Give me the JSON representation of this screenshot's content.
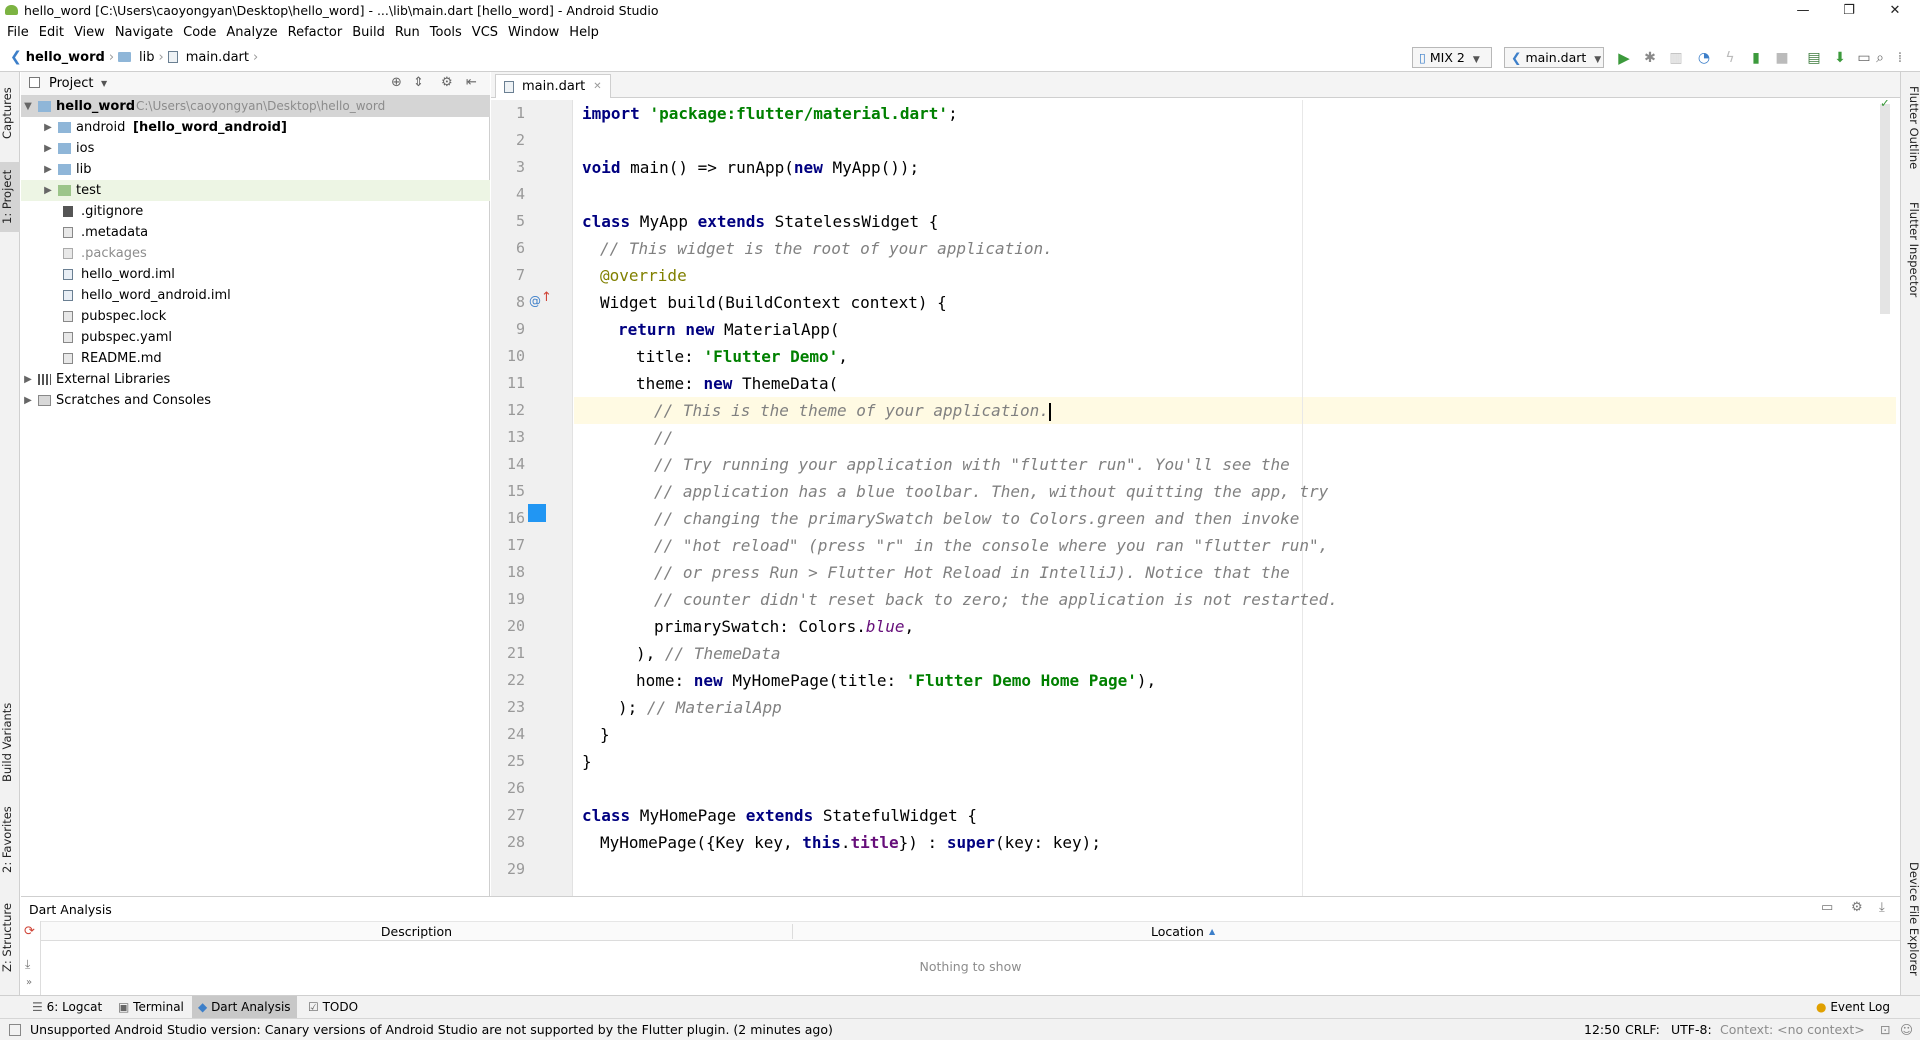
{
  "window": {
    "title": "hello_word [C:\\Users\\caoyongyan\\Desktop\\hello_word] - ...\\lib\\main.dart [hello_word] - Android Studio",
    "minimize": "—",
    "restore": "❐",
    "close": "✕"
  },
  "menu": [
    "File",
    "Edit",
    "View",
    "Navigate",
    "Code",
    "Analyze",
    "Refactor",
    "Build",
    "Run",
    "Tools",
    "VCS",
    "Window",
    "Help"
  ],
  "breadcrumb": {
    "project": "hello_word",
    "folder": "lib",
    "file": "main.dart"
  },
  "toolbar": {
    "device": "MIX 2",
    "run_config": "main.dart"
  },
  "left_strip": {
    "captures": "Captures",
    "project": "1: Project",
    "build_variants": "Build Variants",
    "favorites": "2: Favorites",
    "structure": "Z: Structure"
  },
  "right_strip": {
    "outline": "Flutter Outline",
    "inspector": "Flutter Inspector",
    "device_explorer": "Device File Explorer"
  },
  "project_panel": {
    "view_label": "Project",
    "root": {
      "name": "hello_word",
      "path": "C:\\Users\\caoyongyan\\Desktop\\hello_word"
    },
    "items": [
      {
        "name": "android",
        "suffix": "[hello_word_android]",
        "kind": "folder"
      },
      {
        "name": "ios",
        "kind": "folder"
      },
      {
        "name": "lib",
        "kind": "folder"
      },
      {
        "name": "test",
        "kind": "folder"
      },
      {
        "name": ".gitignore",
        "kind": "file"
      },
      {
        "name": ".metadata",
        "kind": "file"
      },
      {
        "name": ".packages",
        "kind": "file"
      },
      {
        "name": "hello_word.iml",
        "kind": "file"
      },
      {
        "name": "hello_word_android.iml",
        "kind": "file"
      },
      {
        "name": "pubspec.lock",
        "kind": "file"
      },
      {
        "name": "pubspec.yaml",
        "kind": "file"
      },
      {
        "name": "README.md",
        "kind": "file"
      }
    ],
    "external": "External Libraries",
    "scratches": "Scratches and Consoles"
  },
  "editor": {
    "tab": "main.dart",
    "line_numbers": [
      "1",
      "2",
      "3",
      "4",
      "5",
      "6",
      "7",
      "8",
      "9",
      "10",
      "11",
      "12",
      "13",
      "14",
      "15",
      "16",
      "17",
      "18",
      "19",
      "20",
      "21",
      "22",
      "23",
      "24",
      "25",
      "26",
      "27",
      "28",
      "29"
    ],
    "lines": {
      "l1": {
        "kw": "import",
        "s": "'package:flutter/material.dart'",
        "t": ";"
      },
      "l3": {
        "kw": "void",
        "t1": " main() => runApp(",
        "kw2": "new",
        "t2": " MyApp());"
      },
      "l5": {
        "kw": "class",
        "t1": " MyApp ",
        "kw2": "extends",
        "t2": " StatelessWidget {"
      },
      "l6": "// This widget is the root of your application.",
      "l7": "@override",
      "l8": "Widget build(BuildContext context) {",
      "l9": {
        "kw": "return new",
        "t": " MaterialApp("
      },
      "l10": {
        "t": "title: ",
        "s": "'Flutter Demo'",
        "t2": ","
      },
      "l11": {
        "t": "theme: ",
        "kw": "new",
        "t2": " ThemeData("
      },
      "l12": "// This is the theme of your application.",
      "l13": "//",
      "l14": "// Try running your application with \"flutter run\". You'll see the",
      "l15": "// application has a blue toolbar. Then, without quitting the app, try",
      "l16": "// changing the primarySwatch below to Colors.green and then invoke",
      "l17": "// \"hot reload\" (press \"r\" in the console where you ran \"flutter run\",",
      "l18": "// or press Run > Flutter Hot Reload in IntelliJ). Notice that the",
      "l19": "// counter didn't reset back to zero; the application is not restarted.",
      "l20": {
        "t": "primarySwatch: Colors.",
        "p": "blue",
        "t2": ","
      },
      "l21": {
        "t": "), ",
        "c": "// ThemeData"
      },
      "l22": {
        "t": "home: ",
        "kw": "new",
        "t2": " MyHomePage(title: ",
        "s": "'Flutter Demo Home Page'",
        "t3": "),"
      },
      "l23": {
        "t": "); ",
        "c": "// MaterialApp"
      },
      "l24": "}",
      "l25": "}",
      "l27": {
        "kw": "class",
        "t1": " MyHomePage ",
        "kw2": "extends",
        "t2": " StatefulWidget {"
      },
      "l28": {
        "t1": "MyHomePage({Key key, ",
        "kw": "this",
        "t2": ".",
        "p": "title",
        "t3": "}) : ",
        "kw2": "super",
        "t4": "(key: key);"
      }
    }
  },
  "dart_analysis": {
    "title": "Dart Analysis",
    "col_description": "Description",
    "col_location": "Location",
    "sort_marker": "▲",
    "empty": "Nothing to show"
  },
  "bottom_tabs": [
    "6: Logcat",
    "Terminal",
    "Dart Analysis",
    "TODO"
  ],
  "event_log": "Event Log",
  "status": {
    "message": "Unsupported Android Studio version: Canary versions of Android Studio are not supported by the Flutter plugin. (2 minutes ago)",
    "position": "12:50",
    "line_sep": "CRLF:",
    "encoding": "UTF-8:",
    "context": "Context: <no context>"
  },
  "colors": {
    "accent": "#4a90d9",
    "swatch_blue": "#2196f3",
    "run_green": "#3c9a3c",
    "current_line": "#fffae3"
  }
}
